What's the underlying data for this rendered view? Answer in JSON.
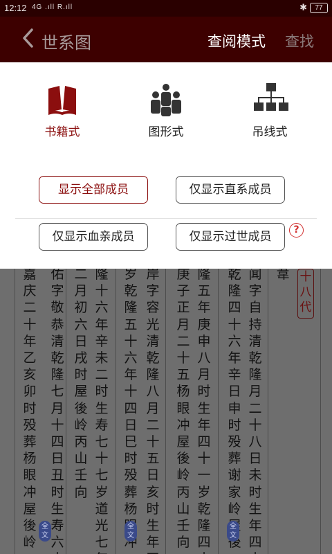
{
  "status_bar": {
    "time": "12:12",
    "signal": "4G .ıll R.ıll",
    "bluetooth": "✱",
    "battery": "77"
  },
  "nav": {
    "title": "世系图",
    "mode_label": "查阅模式",
    "search_label": "查找"
  },
  "view_modes": [
    {
      "label": "书籍式",
      "icon": "book-icon",
      "active": true
    },
    {
      "label": "图形式",
      "icon": "people-group-icon",
      "active": false
    },
    {
      "label": "吊线式",
      "icon": "org-tree-icon",
      "active": false
    }
  ],
  "filters": {
    "all": "显示全部成员",
    "direct": "仅显示直系成员",
    "blood": "仅显示血亲成员",
    "deceased": "仅显示过世成员",
    "help": "?"
  },
  "document": {
    "columns": [
      "嘉庆二十年乙亥卯时殁葬杨眼冲屋後岭",
      "佑字敬恭清乾隆七月十四日丑时生寿六十",
      "二月初六日戌时屋後岭丙山壬向",
      "隆十六年辛未二时生寿七十七岁道光七年",
      "岁乾隆五十六年十四日巳时殁葬杨眼冲",
      "岸字容光清乾隆八月二十五日亥时生年四",
      "庚子正月二十五杨眼冲屋後岭丙山壬向",
      "隆五年庚申八月时生年四十一岁乾隆四十",
      "乾隆四十六年辛日申时殁葬谢家岭屋後",
      "闻字自持清乾隆月二十八日未时生年四十",
      "韋"
    ],
    "badge": "全文",
    "generation_mark": "十八代"
  },
  "colors": {
    "brand": "#8b0e0e",
    "navbar": "#3d0000",
    "statusbar": "#2a0000"
  }
}
